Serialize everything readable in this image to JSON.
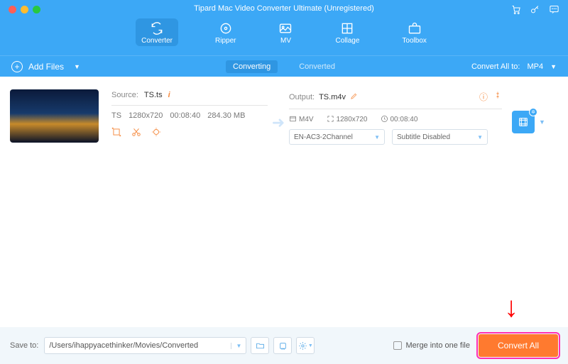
{
  "window": {
    "title": "Tipard Mac Video Converter Ultimate (Unregistered)"
  },
  "tabs": {
    "converter": "Converter",
    "ripper": "Ripper",
    "mv": "MV",
    "collage": "Collage",
    "toolbox": "Toolbox"
  },
  "subbar": {
    "add_files": "Add Files",
    "converting": "Converting",
    "converted": "Converted",
    "convert_all_to": "Convert All to:",
    "format": "MP4"
  },
  "item": {
    "source_label": "Source:",
    "source_file": "TS.ts",
    "ext": "TS",
    "resolution": "1280x720",
    "duration": "00:08:40",
    "size": "284.30 MB",
    "output_label": "Output:",
    "output_file": "TS.m4v",
    "out_container": "M4V",
    "out_resolution": "1280x720",
    "out_duration": "00:08:40",
    "audio_sel": "EN-AC3-2Channel",
    "subtitle_sel": "Subtitle Disabled"
  },
  "footer": {
    "save_to": "Save to:",
    "path": "/Users/ihappyacethinker/Movies/Converted",
    "merge": "Merge into one file",
    "convert_all": "Convert All"
  }
}
